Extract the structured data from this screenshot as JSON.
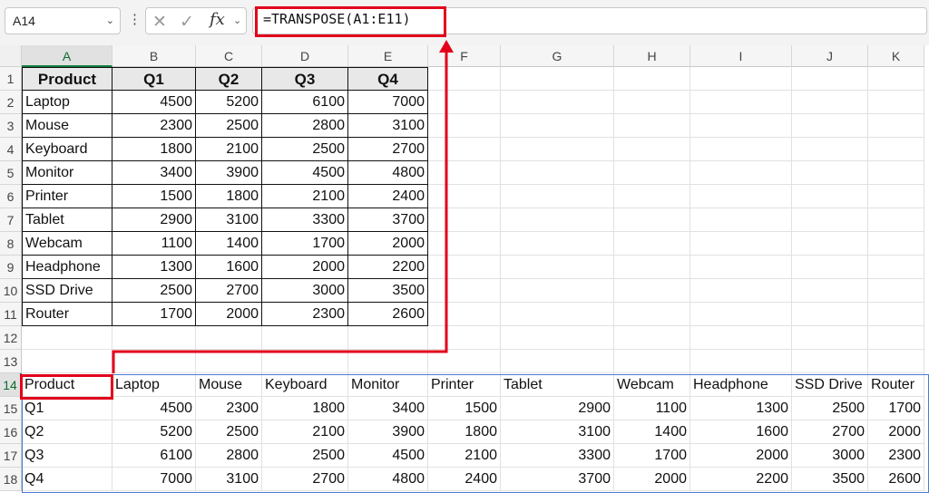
{
  "formula_bar": {
    "name_box": "A14",
    "formula": "=TRANSPOSE(A1:E11)",
    "cancel_icon": "x-icon",
    "confirm_icon": "check-icon",
    "fx_label": "fx"
  },
  "columns": [
    "A",
    "B",
    "C",
    "D",
    "E",
    "F",
    "G",
    "H",
    "I",
    "J",
    "K"
  ],
  "rows": [
    "1",
    "2",
    "3",
    "4",
    "5",
    "6",
    "7",
    "8",
    "9",
    "10",
    "11",
    "12",
    "13",
    "14",
    "15",
    "16",
    "17",
    "18"
  ],
  "source_table": {
    "headers": [
      "Product",
      "Q1",
      "Q2",
      "Q3",
      "Q4"
    ],
    "rows": [
      [
        "Laptop",
        "4500",
        "5200",
        "6100",
        "7000"
      ],
      [
        "Mouse",
        "2300",
        "2500",
        "2800",
        "3100"
      ],
      [
        "Keyboard",
        "1800",
        "2100",
        "2500",
        "2700"
      ],
      [
        "Monitor",
        "3400",
        "3900",
        "4500",
        "4800"
      ],
      [
        "Printer",
        "1500",
        "1800",
        "2100",
        "2400"
      ],
      [
        "Tablet",
        "2900",
        "3100",
        "3300",
        "3700"
      ],
      [
        "Webcam",
        "1100",
        "1400",
        "1700",
        "2000"
      ],
      [
        "Headphone",
        "1300",
        "1600",
        "2000",
        "2200"
      ],
      [
        "SSD Drive",
        "2500",
        "2700",
        "3000",
        "3500"
      ],
      [
        "Router",
        "1700",
        "2000",
        "2300",
        "2600"
      ]
    ]
  },
  "transposed_table": {
    "rows": [
      [
        "Product",
        "Laptop",
        "Mouse",
        "Keyboard",
        "Monitor",
        "Printer",
        "Tablet",
        "Webcam",
        "Headphone",
        "SSD Drive",
        "Router"
      ],
      [
        "Q1",
        "4500",
        "2300",
        "1800",
        "3400",
        "1500",
        "2900",
        "1100",
        "1300",
        "2500",
        "1700"
      ],
      [
        "Q2",
        "5200",
        "2500",
        "2100",
        "3900",
        "1800",
        "3100",
        "1400",
        "1600",
        "2700",
        "2000"
      ],
      [
        "Q3",
        "6100",
        "2800",
        "2500",
        "4500",
        "2100",
        "3300",
        "1700",
        "2000",
        "3000",
        "2300"
      ],
      [
        "Q4",
        "7000",
        "3100",
        "2700",
        "4800",
        "2400",
        "3700",
        "2000",
        "2200",
        "3500",
        "2600"
      ]
    ]
  },
  "colors": {
    "highlight": "#e3001b",
    "spill_border": "#4a7ad6",
    "selected_header": "#107c41"
  }
}
